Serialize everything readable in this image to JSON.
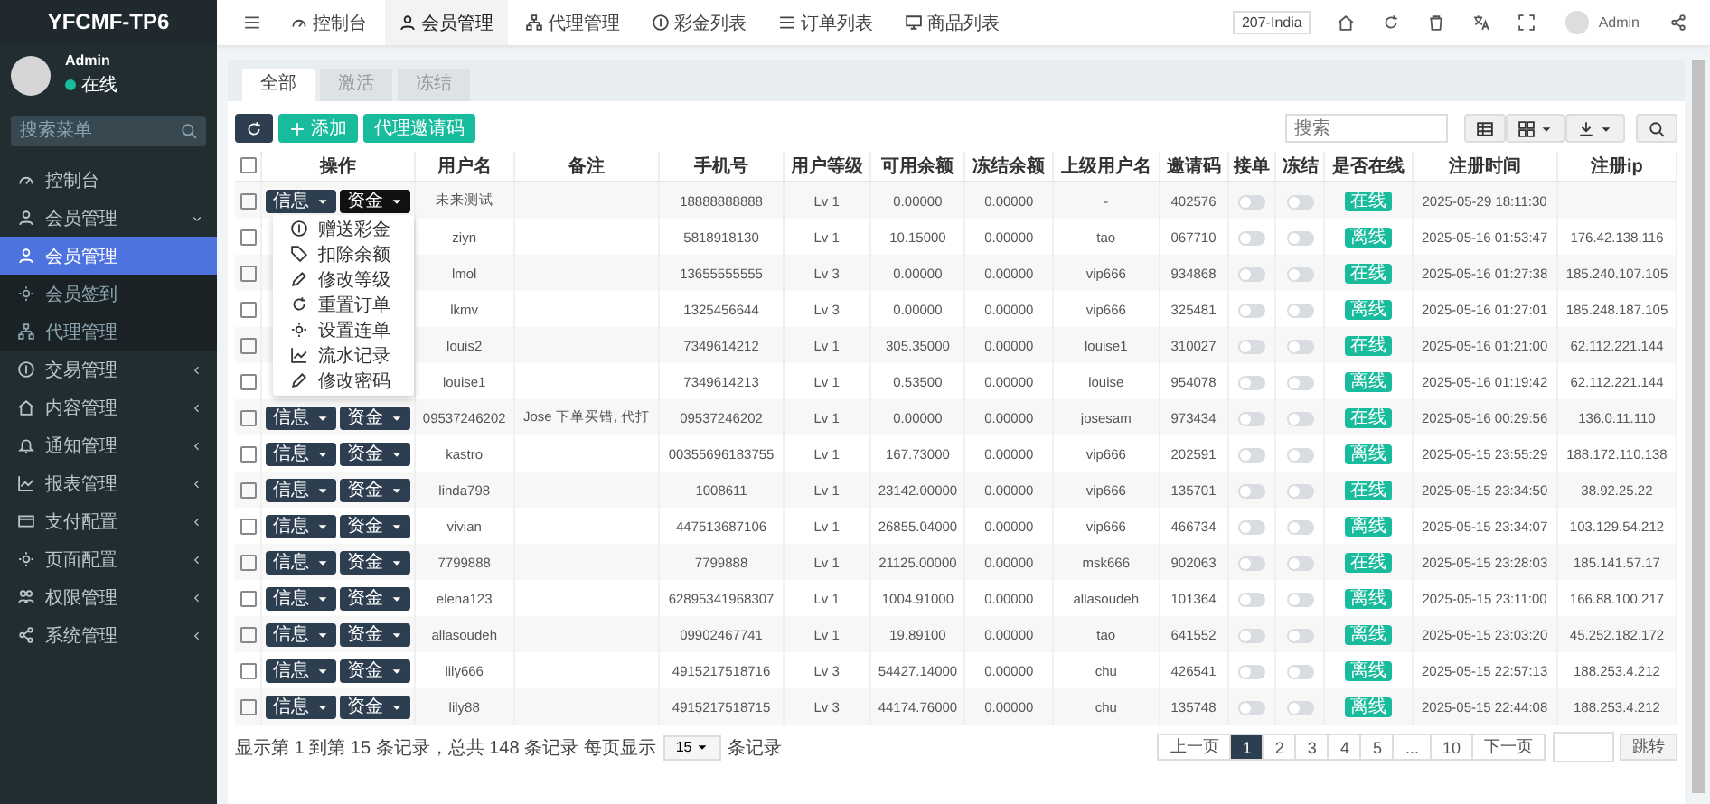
{
  "sidebar": {
    "logo": "YFCMF-TP6",
    "user": {
      "name": "Admin",
      "status": "在线",
      "online": true
    },
    "search": {
      "placeholder": "搜索菜单"
    },
    "items": [
      {
        "label": "控制台",
        "kind": "link",
        "selected": false
      },
      {
        "label": "会员管理",
        "kind": "group",
        "expanded": true,
        "selected": false,
        "children": [
          {
            "label": "会员管理",
            "selected": true
          },
          {
            "label": "会员签到",
            "selected": false
          },
          {
            "label": "代理管理",
            "selected": false
          }
        ]
      },
      {
        "label": "交易管理",
        "kind": "group",
        "expanded": false,
        "selected": false
      },
      {
        "label": "内容管理",
        "kind": "group",
        "expanded": false,
        "selected": false
      },
      {
        "label": "通知管理",
        "kind": "group",
        "expanded": false,
        "selected": false
      },
      {
        "label": "报表管理",
        "kind": "group",
        "expanded": false,
        "selected": false
      },
      {
        "label": "支付配置",
        "kind": "group",
        "expanded": false,
        "selected": false
      },
      {
        "label": "页面配置",
        "kind": "group",
        "expanded": false,
        "selected": false
      },
      {
        "label": "权限管理",
        "kind": "group",
        "expanded": false,
        "selected": false
      },
      {
        "label": "系统管理",
        "kind": "group",
        "expanded": false,
        "selected": false
      }
    ]
  },
  "topbar": {
    "tabs": [
      {
        "label": "控制台",
        "selected": false
      },
      {
        "label": "会员管理",
        "selected": true
      },
      {
        "label": "代理管理",
        "selected": false
      },
      {
        "label": "彩金列表",
        "selected": false
      },
      {
        "label": "订单列表",
        "selected": false
      },
      {
        "label": "商品列表",
        "selected": false
      }
    ],
    "site": "207-India",
    "user": "Admin"
  },
  "tabs": [
    {
      "label": "全部",
      "selected": true
    },
    {
      "label": "激活",
      "selected": false
    },
    {
      "label": "冻结",
      "selected": false
    }
  ],
  "toolbar": {
    "add": "添加",
    "invite": "代理邀请码",
    "search": {
      "placeholder": "搜索"
    }
  },
  "table": {
    "select_all": false,
    "columns": [
      "操作",
      "用户名",
      "备注",
      "手机号",
      "用户等级",
      "可用余额",
      "冻结余额",
      "上级用户名",
      "邀请码",
      "接单",
      "冻结",
      "是否在线",
      "注册时间",
      "注册ip"
    ],
    "rows": [
      {
        "checked": false,
        "ops": [
          {
            "label": "信息",
            "open": false
          },
          {
            "label": "资金",
            "open": true,
            "menu": [
              "赠送彩金",
              "扣除余额",
              "修改等级",
              "重置订单",
              "设置连单",
              "流水记录",
              "修改密码"
            ]
          }
        ],
        "username": "未来测试",
        "phone": "18888888888",
        "level": "Lv 1",
        "balance": "0.00000",
        "frozen": "0.00000",
        "parent": "-",
        "invite": "402576",
        "take_orders": false,
        "frozen_on": false,
        "status": "在线",
        "registered": "2025-05-29 18:11:30"
      },
      {
        "checked": false,
        "username": "ziyn",
        "phone": "5818918130",
        "level": "Lv 1",
        "balance": "10.15000",
        "frozen": "0.00000",
        "parent": "tao",
        "invite": "067710",
        "take_orders": false,
        "frozen_on": false,
        "status": "离线",
        "registered": "2025-05-16 01:53:47",
        "ip": "176.42.138.116"
      },
      {
        "checked": false,
        "username": "lmol",
        "phone": "13655555555",
        "level": "Lv 3",
        "balance": "0.00000",
        "frozen": "0.00000",
        "parent": "vip666",
        "invite": "934868",
        "take_orders": false,
        "frozen_on": false,
        "status": "在线",
        "registered": "2025-05-16 01:27:38",
        "ip": "185.240.107.105"
      },
      {
        "checked": false,
        "username": "lkmv",
        "phone": "1325456644",
        "level": "Lv 3",
        "balance": "0.00000",
        "frozen": "0.00000",
        "parent": "vip666",
        "invite": "325481",
        "take_orders": false,
        "frozen_on": false,
        "status": "离线",
        "registered": "2025-05-16 01:27:01",
        "ip": "185.248.187.105"
      },
      {
        "checked": false,
        "username": "louis2",
        "phone": "7349614212",
        "level": "Lv 1",
        "balance": "305.35000",
        "frozen": "0.00000",
        "parent": "louise1",
        "invite": "310027",
        "take_orders": false,
        "frozen_on": false,
        "status": "在线",
        "registered": "2025-05-16 01:21:00",
        "ip": "62.112.221.144"
      },
      {
        "checked": false,
        "username": "louise1",
        "phone": "7349614213",
        "level": "Lv 1",
        "balance": "0.53500",
        "frozen": "0.00000",
        "parent": "louise",
        "invite": "954078",
        "take_orders": false,
        "frozen_on": false,
        "status": "离线",
        "registered": "2025-05-16 01:19:42",
        "ip": "62.112.221.144"
      },
      {
        "checked": false,
        "ops": [
          {
            "label": "信息",
            "open": false
          },
          {
            "label": "资金",
            "open": false
          }
        ],
        "username": "09537246202",
        "note": "Jose 下单买错, 代打",
        "phone": "09537246202",
        "level": "Lv 1",
        "balance": "0.00000",
        "frozen": "0.00000",
        "parent": "josesam",
        "invite": "973434",
        "take_orders": false,
        "frozen_on": false,
        "status": "在线",
        "registered": "2025-05-16 00:29:56",
        "ip": "136.0.11.110"
      },
      {
        "checked": false,
        "ops": [
          {
            "label": "信息",
            "open": false
          },
          {
            "label": "资金",
            "open": false
          }
        ],
        "username": "kastro",
        "phone": "00355696183755",
        "level": "Lv 1",
        "balance": "167.73000",
        "frozen": "0.00000",
        "parent": "vip666",
        "invite": "202591",
        "take_orders": false,
        "frozen_on": false,
        "status": "离线",
        "registered": "2025-05-15 23:55:29",
        "ip": "188.172.110.138"
      },
      {
        "checked": false,
        "ops": [
          {
            "label": "信息",
            "open": false
          },
          {
            "label": "资金",
            "open": false
          }
        ],
        "username": "linda798",
        "phone": "1008611",
        "level": "Lv 1",
        "balance": "23142.00000",
        "frozen": "0.00000",
        "parent": "vip666",
        "invite": "135701",
        "take_orders": false,
        "frozen_on": false,
        "status": "在线",
        "registered": "2025-05-15 23:34:50",
        "ip": "38.92.25.22"
      },
      {
        "checked": false,
        "ops": [
          {
            "label": "信息",
            "open": false
          },
          {
            "label": "资金",
            "open": false
          }
        ],
        "username": "vivian",
        "phone": "447513687106",
        "level": "Lv 1",
        "balance": "26855.04000",
        "frozen": "0.00000",
        "parent": "vip666",
        "invite": "466734",
        "take_orders": false,
        "frozen_on": false,
        "status": "离线",
        "registered": "2025-05-15 23:34:07",
        "ip": "103.129.54.212"
      },
      {
        "checked": false,
        "ops": [
          {
            "label": "信息",
            "open": false
          },
          {
            "label": "资金",
            "open": false
          }
        ],
        "username": "7799888",
        "phone": "7799888",
        "level": "Lv 1",
        "balance": "21125.00000",
        "frozen": "0.00000",
        "parent": "msk666",
        "invite": "902063",
        "take_orders": false,
        "frozen_on": false,
        "status": "在线",
        "registered": "2025-05-15 23:28:03",
        "ip": "185.141.57.17"
      },
      {
        "checked": false,
        "ops": [
          {
            "label": "信息",
            "open": false
          },
          {
            "label": "资金",
            "open": false
          }
        ],
        "username": "elena123",
        "phone": "62895341968307",
        "level": "Lv 1",
        "balance": "1004.91000",
        "frozen": "0.00000",
        "parent": "allasoudeh",
        "invite": "101364",
        "take_orders": false,
        "frozen_on": false,
        "status": "离线",
        "registered": "2025-05-15 23:11:00",
        "ip": "166.88.100.217"
      },
      {
        "checked": false,
        "ops": [
          {
            "label": "信息",
            "open": false
          },
          {
            "label": "资金",
            "open": false
          }
        ],
        "username": "allasoudeh",
        "phone": "09902467741",
        "level": "Lv 1",
        "balance": "19.89100",
        "frozen": "0.00000",
        "parent": "tao",
        "invite": "641552",
        "take_orders": false,
        "frozen_on": false,
        "status": "离线",
        "registered": "2025-05-15 23:03:20",
        "ip": "45.252.182.172"
      },
      {
        "checked": false,
        "ops": [
          {
            "label": "信息",
            "open": false
          },
          {
            "label": "资金",
            "open": false
          }
        ],
        "username": "lily666",
        "phone": "4915217518716",
        "level": "Lv 3",
        "balance": "54427.14000",
        "frozen": "0.00000",
        "parent": "chu",
        "invite": "426541",
        "take_orders": false,
        "frozen_on": false,
        "status": "离线",
        "registered": "2025-05-15 22:57:13",
        "ip": "188.253.4.212"
      },
      {
        "checked": false,
        "ops": [
          {
            "label": "信息",
            "open": false
          },
          {
            "label": "资金",
            "open": false
          }
        ],
        "username": "lily88",
        "phone": "4915217518715",
        "level": "Lv 3",
        "balance": "44174.76000",
        "frozen": "0.00000",
        "parent": "chu",
        "invite": "135748",
        "take_orders": false,
        "frozen_on": false,
        "status": "离线",
        "registered": "2025-05-15 22:44:08",
        "ip": "188.253.4.212"
      }
    ]
  },
  "footer": {
    "summary": "显示第 1 到第 15 条记录，总共 148 条记录 每页显示",
    "page_size": "15",
    "suffix": "条记录"
  },
  "pagination": {
    "prev": "上一页",
    "pages": [
      {
        "label": "1",
        "selected": true
      },
      {
        "label": "2",
        "selected": false
      },
      {
        "label": "3",
        "selected": false
      },
      {
        "label": "4",
        "selected": false
      },
      {
        "label": "5",
        "selected": false
      },
      {
        "label": "...",
        "selected": false
      },
      {
        "label": "10",
        "selected": false
      }
    ],
    "next": "下一页",
    "go": "跳转"
  }
}
